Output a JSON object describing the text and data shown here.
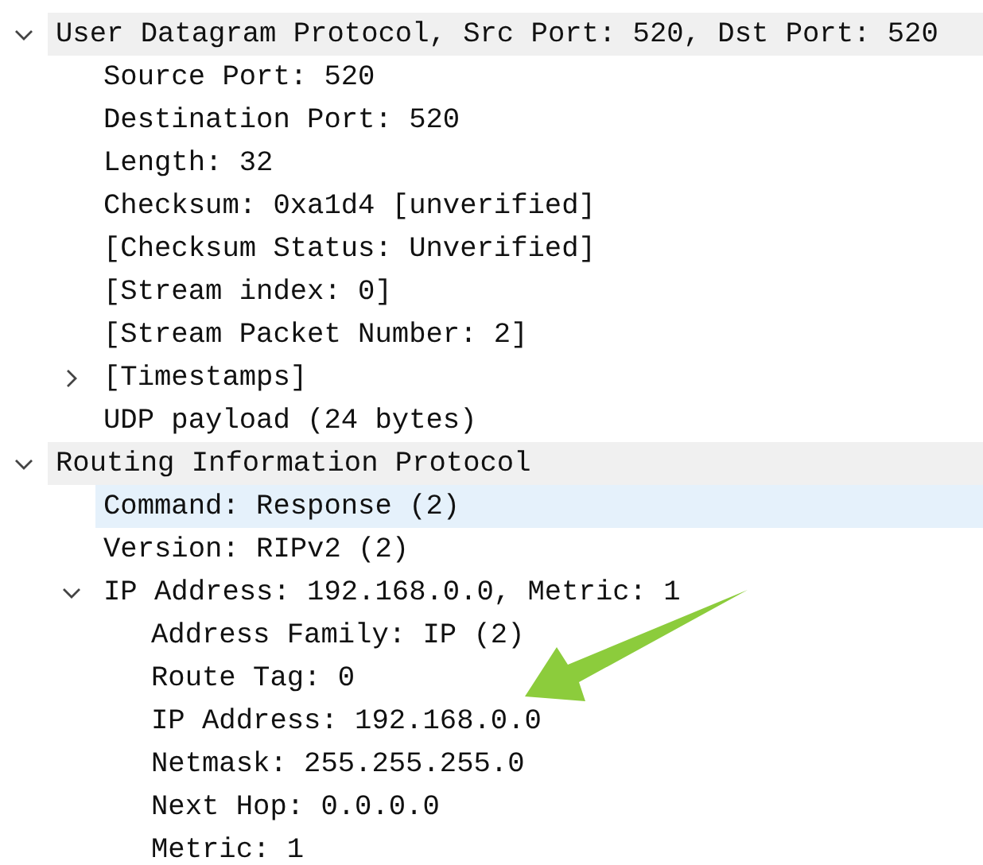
{
  "tree": [
    {
      "label": "User Datagram Protocol, Src Port: 520, Dst Port: 520",
      "expanded": true,
      "selected": false,
      "children": [
        {
          "label": "Source Port: 520",
          "selected": false
        },
        {
          "label": "Destination Port: 520",
          "selected": false
        },
        {
          "label": "Length: 32",
          "selected": false
        },
        {
          "label": "Checksum: 0xa1d4 [unverified]",
          "selected": false
        },
        {
          "label": "[Checksum Status: Unverified]",
          "selected": false
        },
        {
          "label": "[Stream index: 0]",
          "selected": false
        },
        {
          "label": "[Stream Packet Number: 2]",
          "selected": false
        },
        {
          "label": "[Timestamps]",
          "expanded": false,
          "selected": false
        },
        {
          "label": "UDP payload (24 bytes)",
          "selected": false
        }
      ]
    },
    {
      "label": "Routing Information Protocol",
      "expanded": true,
      "selected": false,
      "children": [
        {
          "label": "Command: Response (2)",
          "selected": true
        },
        {
          "label": "Version: RIPv2 (2)",
          "selected": false
        },
        {
          "label": "IP Address: 192.168.0.0, Metric: 1",
          "expanded": true,
          "selected": false,
          "children": [
            {
              "label": "Address Family: IP (2)",
              "selected": false
            },
            {
              "label": "Route Tag: 0",
              "selected": false
            },
            {
              "label": "IP Address: 192.168.0.0",
              "selected": false
            },
            {
              "label": "Netmask: 255.255.255.0",
              "selected": false
            },
            {
              "label": "Next Hop: 0.0.0.0",
              "selected": false
            },
            {
              "label": "Metric: 1",
              "selected": false
            }
          ]
        }
      ]
    }
  ]
}
